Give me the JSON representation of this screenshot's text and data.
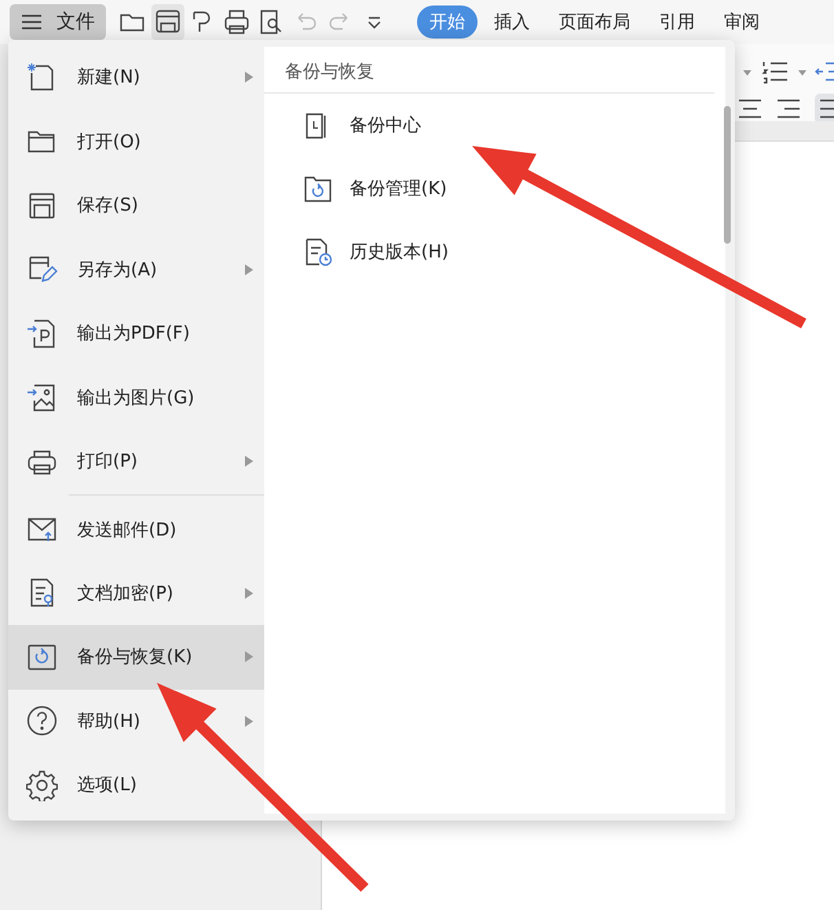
{
  "toolbar": {
    "file_button": "文件",
    "tabs": [
      {
        "label": "开始",
        "selected": true
      },
      {
        "label": "插入",
        "selected": false
      },
      {
        "label": "页面布局",
        "selected": false
      },
      {
        "label": "引用",
        "selected": false
      },
      {
        "label": "审阅",
        "selected": false
      }
    ]
  },
  "file_menu": {
    "items": [
      {
        "label": "新建(N)",
        "has_submenu": true,
        "selected": false,
        "separator_above": false
      },
      {
        "label": "打开(O)",
        "has_submenu": false,
        "selected": false,
        "separator_above": false
      },
      {
        "label": "保存(S)",
        "has_submenu": false,
        "selected": false,
        "separator_above": false
      },
      {
        "label": "另存为(A)",
        "has_submenu": true,
        "selected": false,
        "separator_above": false
      },
      {
        "label": "输出为PDF(F)",
        "has_submenu": false,
        "selected": false,
        "separator_above": false
      },
      {
        "label": "输出为图片(G)",
        "has_submenu": false,
        "selected": false,
        "separator_above": false
      },
      {
        "label": "打印(P)",
        "has_submenu": true,
        "selected": false,
        "separator_above": false
      },
      {
        "label": "发送邮件(D)",
        "has_submenu": false,
        "selected": false,
        "separator_above": true
      },
      {
        "label": "文档加密(P)",
        "has_submenu": true,
        "selected": false,
        "separator_above": false
      },
      {
        "label": "备份与恢复(K)",
        "has_submenu": true,
        "selected": true,
        "separator_above": false
      },
      {
        "label": "帮助(H)",
        "has_submenu": true,
        "selected": false,
        "separator_above": false
      },
      {
        "label": "选项(L)",
        "has_submenu": false,
        "selected": false,
        "separator_above": false
      }
    ]
  },
  "submenu": {
    "title": "备份与恢复",
    "items": [
      {
        "label": "备份中心"
      },
      {
        "label": "备份管理(K)"
      },
      {
        "label": "历史版本(H)"
      }
    ]
  }
}
